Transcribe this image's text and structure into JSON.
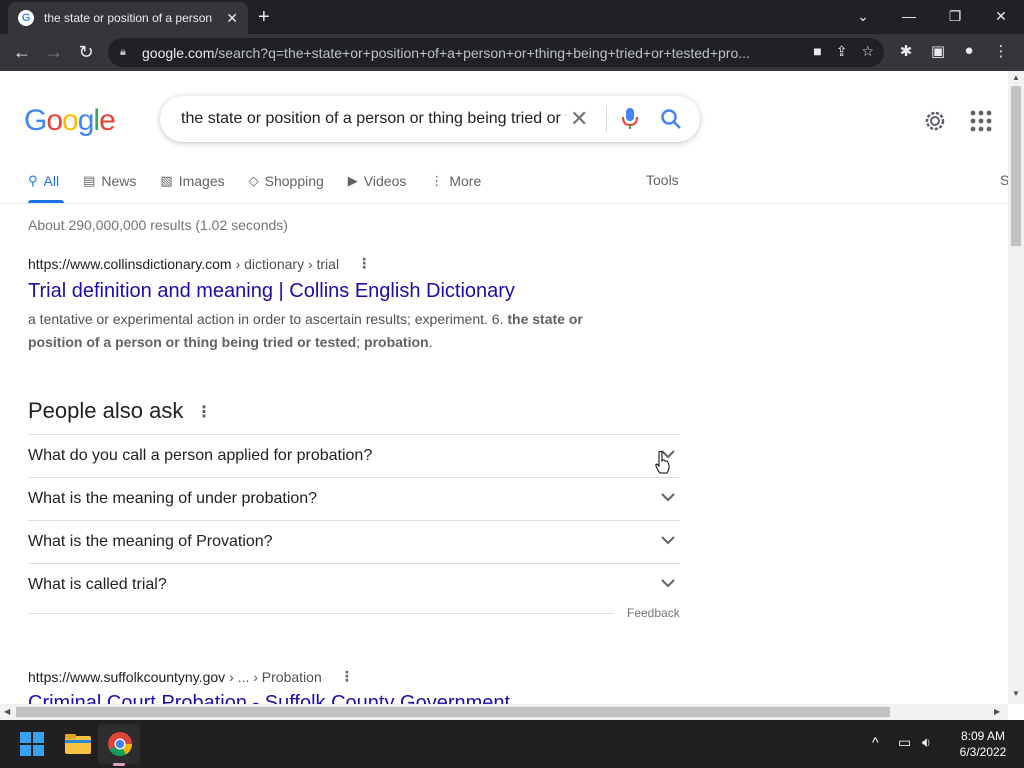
{
  "browser": {
    "tab_title": "the state or position of a person",
    "tab_favicon": "G",
    "url_host": "google.com",
    "url_rest": "/search?q=the+state+or+position+of+a+person+or+thing+being+tried+or+tested+pro..."
  },
  "search": {
    "logo": [
      "G",
      "o",
      "o",
      "g",
      "l",
      "e"
    ],
    "query": "the state or position of a person or thing being tried or tested probation"
  },
  "tabs": [
    {
      "label": "All",
      "icon": "search-icon"
    },
    {
      "label": "News",
      "icon": "news-icon"
    },
    {
      "label": "Images",
      "icon": "image-icon"
    },
    {
      "label": "Shopping",
      "icon": "tag-icon"
    },
    {
      "label": "Videos",
      "icon": "play-icon"
    },
    {
      "label": "More",
      "icon": "more-vert-icon"
    }
  ],
  "tools_label": "Tools",
  "cut_label": "S",
  "stats": "About 290,000,000 results (1.02 seconds)",
  "result1": {
    "host": "https://www.collinsdictionary.com",
    "path": "› dictionary › trial",
    "title": "Trial definition and meaning | Collins English Dictionary",
    "snippet_a": "a tentative or experimental action in order to ascertain results; experiment. 6. ",
    "snippet_b": "the state or position of a person or thing being tried or tested",
    "snippet_c": "; ",
    "snippet_d": "probation",
    "snippet_e": "."
  },
  "paa": {
    "title": "People also ask",
    "questions": [
      "What do you call a person applied for probation?",
      "What is the meaning of under probation?",
      "What is the meaning of Provation?",
      "What is called trial?"
    ],
    "feedback": "Feedback"
  },
  "result2": {
    "host": "https://www.suffolkcountyny.gov",
    "path": "› ... › Probation",
    "title": "Criminal Court Probation - Suffolk County Government"
  },
  "clock": {
    "time": "8:09 AM",
    "date": "6/3/2022"
  },
  "colors": {
    "link": "#1a0dab",
    "accent": "#1a73e8"
  }
}
